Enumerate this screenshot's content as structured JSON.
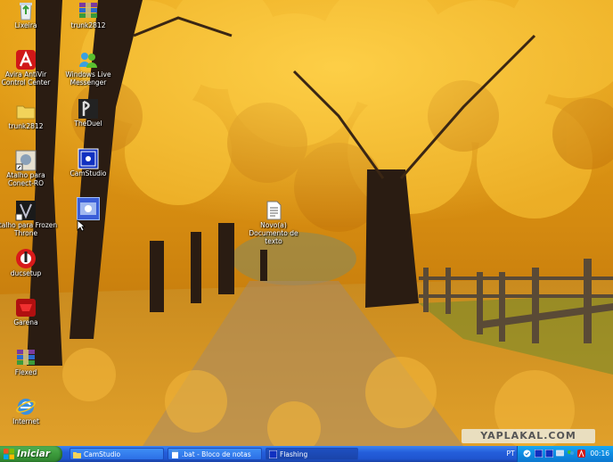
{
  "desktop": {
    "icons": [
      {
        "label": "Lixeira",
        "icon": "recycle-bin-icon"
      },
      {
        "label": "trunk2812",
        "icon": "rar-archive-icon"
      },
      {
        "label": "Avira AntiVir Control Center",
        "icon": "avira-icon"
      },
      {
        "label": "Windows Live Messenger",
        "icon": "messenger-icon"
      },
      {
        "label": "trunk2812",
        "icon": "folder-icon"
      },
      {
        "label": "TheDuel",
        "icon": "theduel-icon"
      },
      {
        "label": "Atalho para Conect-RO",
        "icon": "shortcut-icon"
      },
      {
        "label": "CamStudio",
        "icon": "camstudio-icon"
      },
      {
        "label": "Atalho para Frozen Throne",
        "icon": "frozen-throne-icon"
      },
      {
        "label": "",
        "icon": "selected-app-icon"
      },
      {
        "label": "Novo(a) Documento de texto",
        "icon": "text-document-icon"
      },
      {
        "label": "ducsetup",
        "icon": "ducsetup-icon"
      },
      {
        "label": "Garena",
        "icon": "garena-icon"
      },
      {
        "label": "Flexed",
        "icon": "rar-archive-icon"
      },
      {
        "label": "Internet",
        "icon": "internet-explorer-icon"
      }
    ]
  },
  "watermark": "YAPLAKAL.COM",
  "taskbar": {
    "start_label": "Iniciar",
    "tasks": [
      {
        "label": "CamStudio",
        "icon": "folder-icon"
      },
      {
        "label": ".bat - Bloco de notas",
        "icon": "notepad-icon"
      },
      {
        "label": "Flashing",
        "icon": "flashing-app-icon"
      }
    ],
    "language": "PT",
    "clock": "00:16"
  },
  "colors": {
    "taskbar_blue": "#245edb",
    "start_green": "#3c9b3c",
    "tray_blue": "#0e8be2"
  }
}
